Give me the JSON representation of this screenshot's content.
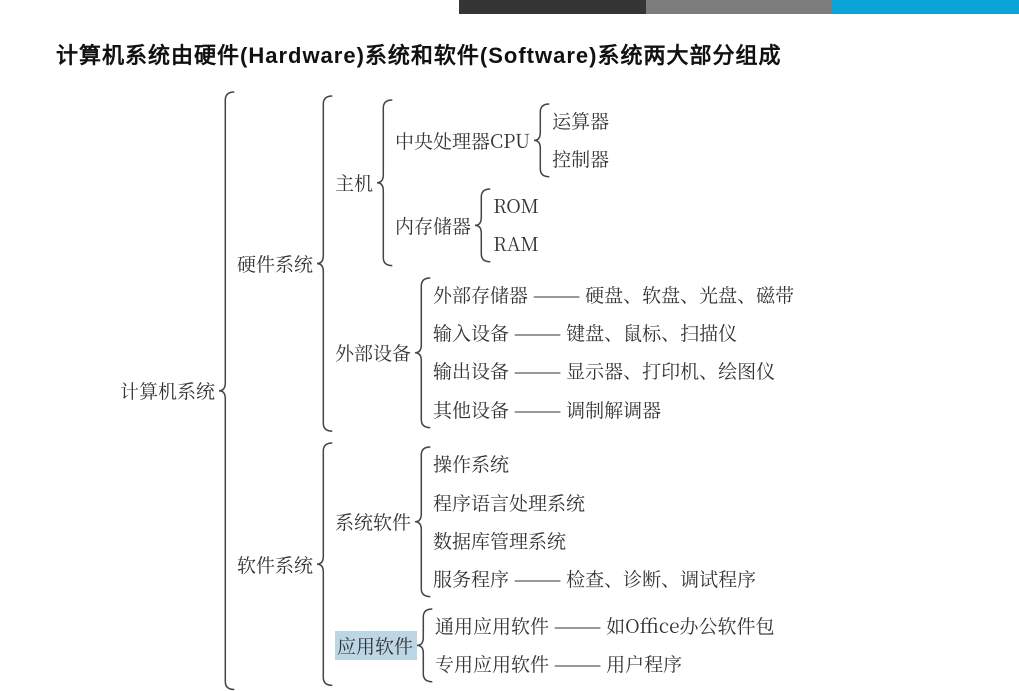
{
  "title": "计算机系统由硬件(Hardware)系统和软件(Software)系统两大部分组成",
  "tree": {
    "root": "计算机系统",
    "hw": {
      "label": "硬件系统",
      "host": {
        "label": "主机",
        "cpu": {
          "label": "中央处理器CPU",
          "alu": "运算器",
          "cu": "控制器"
        },
        "mem": {
          "label": "内存储器",
          "rom": "ROM",
          "ram": "RAM"
        }
      },
      "ext": {
        "label": "外部设备",
        "storage": "外部存储器 ——— 硬盘、软盘、光盘、磁带",
        "input": "输入设备 ——— 键盘、鼠标、扫描仪",
        "output": "输出设备 ——— 显示器、打印机、绘图仪",
        "other": "其他设备 ——— 调制解调器"
      }
    },
    "sw": {
      "label": "软件系统",
      "sys": {
        "label": "系统软件",
        "os": "操作系统",
        "lang": "程序语言处理系统",
        "db": "数据库管理系统",
        "svc": "服务程序 ——— 检查、诊断、调试程序"
      },
      "app": {
        "label": "应用软件",
        "general": "通用应用软件 ——— 如Office办公软件包",
        "special": "专用应用软件 ——— 用户程序"
      }
    }
  }
}
